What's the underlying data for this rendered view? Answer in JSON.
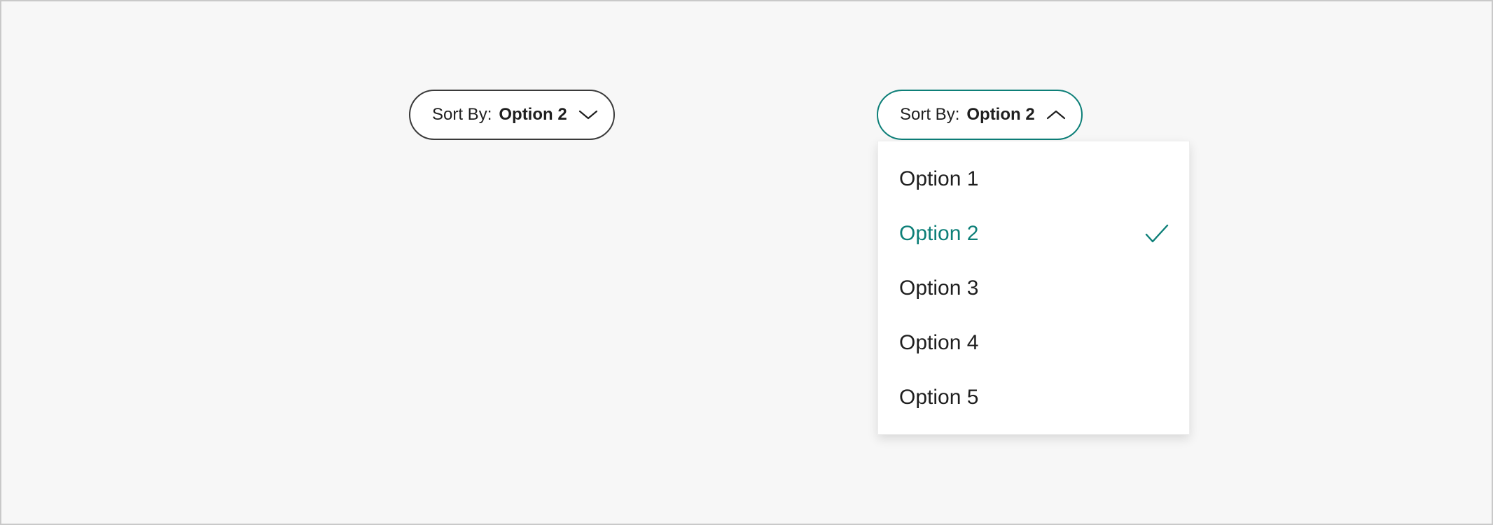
{
  "sort_closed": {
    "label": "Sort By:",
    "value": "Option 2",
    "icon": "chevron-down-icon"
  },
  "sort_open": {
    "label": "Sort By:",
    "value": "Option 2",
    "icon": "chevron-up-icon"
  },
  "dropdown": {
    "options": [
      {
        "label": "Option 1",
        "selected": false
      },
      {
        "label": "Option 2",
        "selected": true
      },
      {
        "label": "Option 3",
        "selected": false
      },
      {
        "label": "Option 4",
        "selected": false
      },
      {
        "label": "Option 5",
        "selected": false
      }
    ],
    "selected_icon": "checkmark-icon"
  },
  "colors": {
    "accent": "#0d7f78",
    "text": "#1f1f1f",
    "border_default": "#3a3a3a",
    "background": "#f7f7f7",
    "menu_background": "#ffffff"
  }
}
